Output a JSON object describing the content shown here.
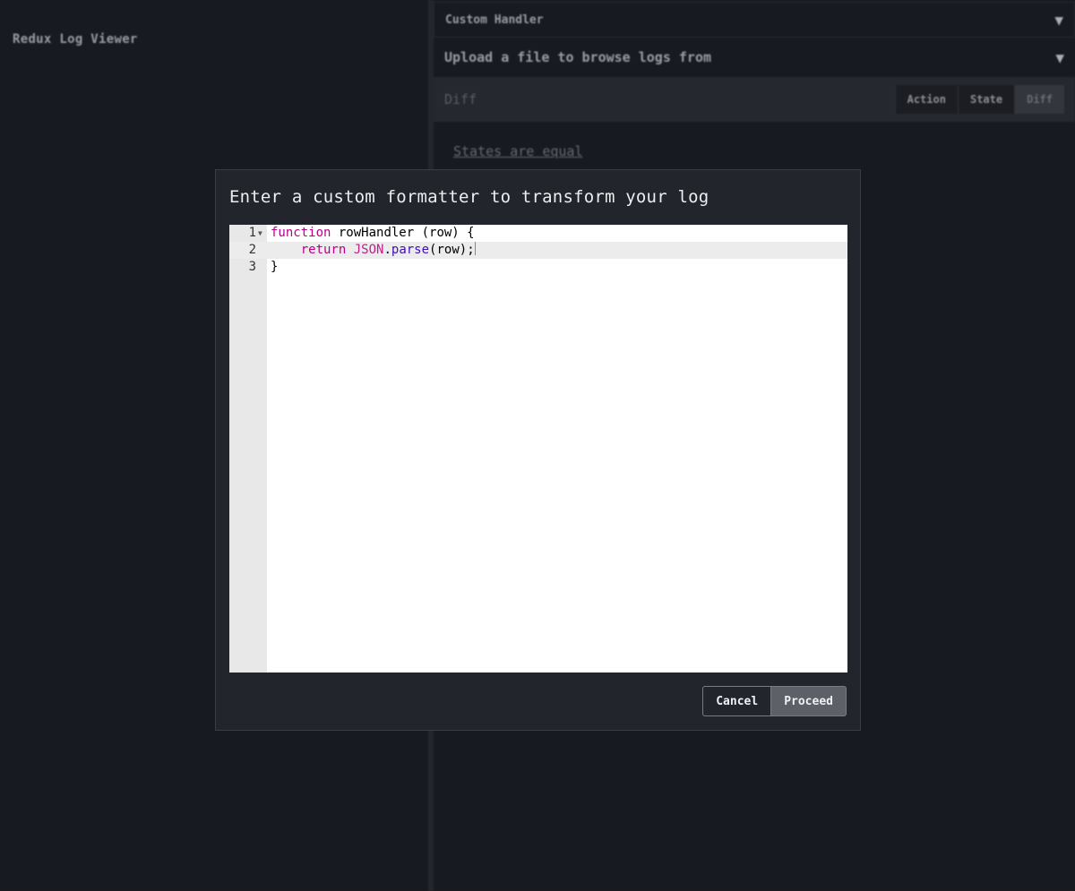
{
  "app": {
    "title": "Redux Log Viewer"
  },
  "panel": {
    "custom_handler": "Custom Handler",
    "upload": "Upload a file to browse logs from",
    "diff_title": "Diff",
    "tabs": [
      "Action",
      "State",
      "Diff"
    ],
    "active_tab": "Diff",
    "message": "States are equal"
  },
  "modal": {
    "title": "Enter a custom formatter to transform your log",
    "code": {
      "lines": [
        {
          "number": "1",
          "text": "function rowHandler (row) {"
        },
        {
          "number": "2",
          "text": "    return JSON.parse(row);"
        },
        {
          "number": "3",
          "text": "}"
        }
      ]
    },
    "cancel_label": "Cancel",
    "proceed_label": "Proceed"
  }
}
